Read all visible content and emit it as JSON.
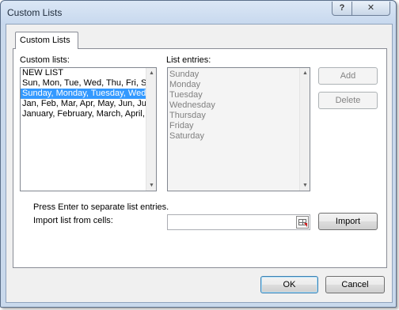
{
  "window": {
    "title": "Custom Lists",
    "help_label": "?",
    "close_label": "✕"
  },
  "tab": {
    "label": "Custom Lists"
  },
  "custom_lists": {
    "label": "Custom lists:",
    "items": [
      "NEW LIST",
      "Sun, Mon, Tue, Wed, Thu, Fri, Sat",
      "Sunday, Monday, Tuesday, Wednesday, Thursday, Friday, Saturday",
      "Jan, Feb, Mar, Apr, May, Jun, Jul, Aug, Sep, Oct, Nov, Dec",
      "January, February, March, April, May, June, July, August, September, October, November, December"
    ],
    "selected_index": 2
  },
  "list_entries": {
    "label": "List entries:",
    "items": [
      "Sunday",
      "Monday",
      "Tuesday",
      "Wednesday",
      "Thursday",
      "Friday",
      "Saturday"
    ]
  },
  "buttons": {
    "add": "Add",
    "delete": "Delete",
    "import": "Import",
    "ok": "OK",
    "cancel": "Cancel"
  },
  "hint_text": "Press Enter to separate list entries.",
  "import_label": "Import list from cells:",
  "import_value": "",
  "icons": {
    "collapse_dialog": "range-select-icon",
    "scroll_up": "scroll-up-arrow-icon",
    "scroll_down": "scroll-down-arrow-icon"
  },
  "colors": {
    "selection": "#3399ff",
    "title_bar": "#c9d9ec"
  }
}
